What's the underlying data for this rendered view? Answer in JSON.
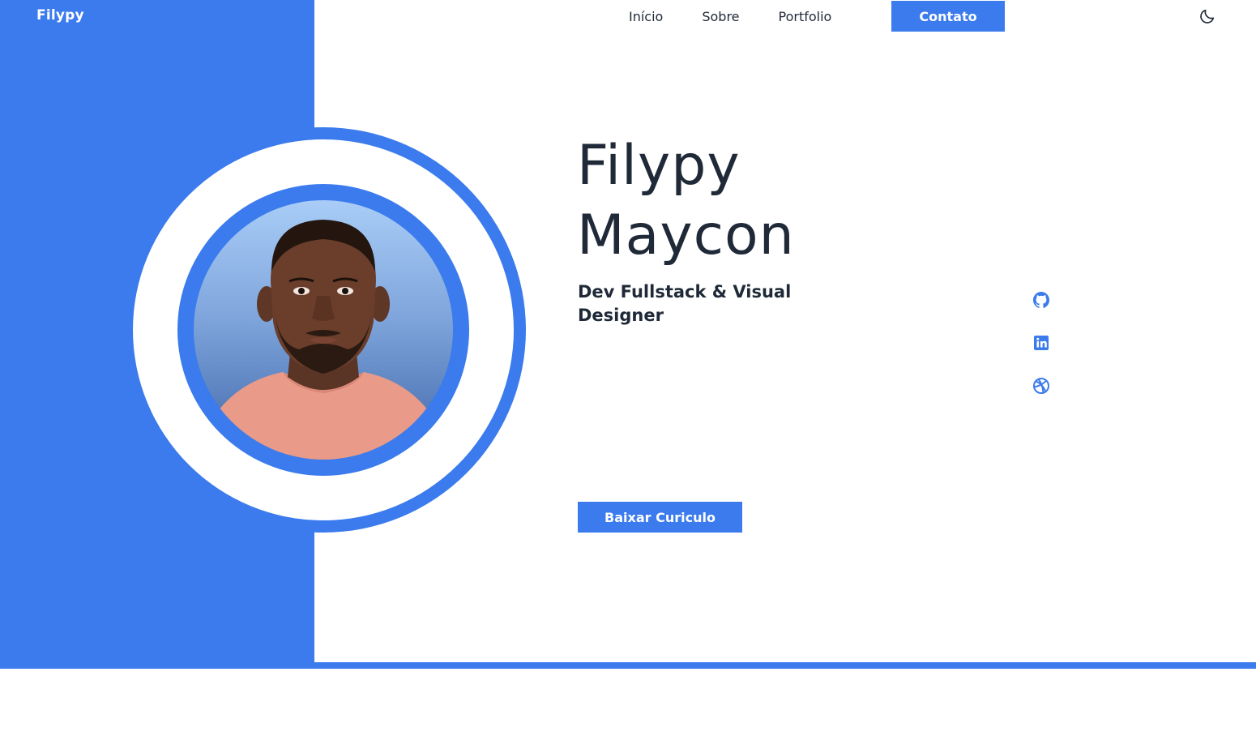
{
  "brand": {
    "logo": "Filypy",
    "accent_color": "#3b7bed",
    "text_color": "#1f2937"
  },
  "nav": {
    "items": [
      {
        "label": "Início"
      },
      {
        "label": "Sobre"
      },
      {
        "label": "Portfolio"
      }
    ],
    "cta_label": "Contato",
    "theme_toggle_icon": "moon-icon"
  },
  "hero": {
    "first_name": "Filypy",
    "last_name": "Maycon",
    "subtitle": "Dev Fullstack & Visual Designer",
    "cv_button_label": "Baixar Curiculo",
    "avatar_icon": "profile-photo"
  },
  "social": {
    "items": [
      {
        "icon": "github-icon"
      },
      {
        "icon": "linkedin-icon"
      },
      {
        "icon": "dribbble-icon"
      }
    ]
  }
}
